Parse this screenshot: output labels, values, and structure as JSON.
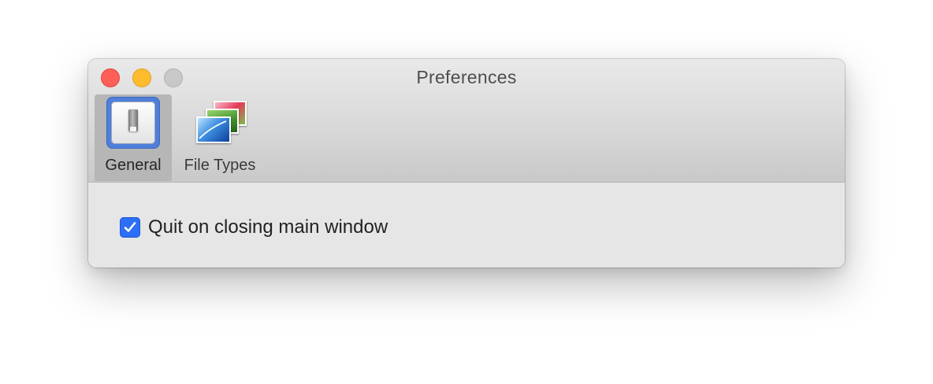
{
  "window": {
    "title": "Preferences"
  },
  "toolbar": {
    "items": [
      {
        "label": "General",
        "icon": "switch-icon",
        "selected": true
      },
      {
        "label": "File Types",
        "icon": "photos-icon",
        "selected": false
      }
    ]
  },
  "general": {
    "quit_on_close": {
      "label": "Quit on closing main window",
      "checked": true
    }
  },
  "colors": {
    "accent": "#2d6ff7",
    "close": "#fe5f57",
    "minimize": "#febc2e",
    "zoom_disabled": "#c8c8c8"
  }
}
